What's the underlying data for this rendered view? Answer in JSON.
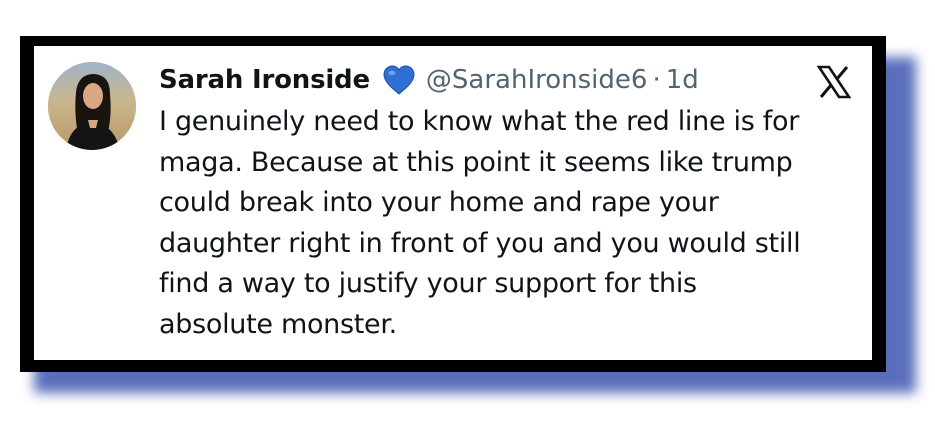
{
  "tweet": {
    "display_name": "Sarah Ironside",
    "verified_icon": "blue-heart-icon",
    "handle": "@SarahIronside6",
    "separator": "·",
    "time_ago": "1d",
    "platform_icon": "x-logo-icon",
    "text_lines": [
      "I genuinely need to know what the red line is for",
      "maga. Because at this point it seems like trump",
      "could break into your home and rape your",
      "daughter right in front of you and you would still",
      "find a way to justify your support for this",
      "absolute monster."
    ]
  },
  "colors": {
    "frame": "#000000",
    "shadow": "#4a5fb5",
    "heart": "#2f6fd6",
    "name": "#0f1419",
    "muted": "#536471"
  }
}
